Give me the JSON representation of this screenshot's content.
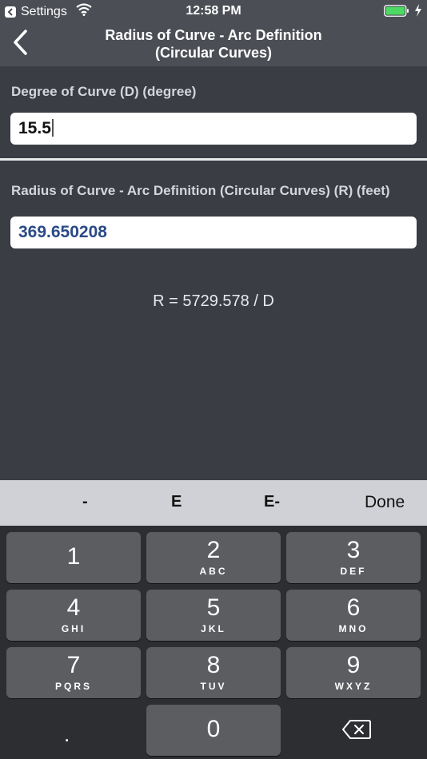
{
  "status": {
    "back_app": "Settings",
    "time": "12:58 PM"
  },
  "nav": {
    "title_line1": "Radius of Curve - Arc Definition",
    "title_line2": "(Circular Curves)"
  },
  "input": {
    "label": "Degree of Curve (D) (degree)",
    "value": "15.5"
  },
  "output": {
    "label": "Radius of Curve - Arc Definition (Circular Curves) (R) (feet)",
    "value": "369.650208"
  },
  "formula": "R = 5729.578 / D",
  "accessory": {
    "minus": "-",
    "e": "E",
    "e_minus": "E-",
    "done": "Done"
  },
  "keypad": {
    "keys": [
      {
        "num": "1",
        "letters": ""
      },
      {
        "num": "2",
        "letters": "ABC"
      },
      {
        "num": "3",
        "letters": "DEF"
      },
      {
        "num": "4",
        "letters": "GHI"
      },
      {
        "num": "5",
        "letters": "JKL"
      },
      {
        "num": "6",
        "letters": "MNO"
      },
      {
        "num": "7",
        "letters": "PQRS"
      },
      {
        "num": "8",
        "letters": "TUV"
      },
      {
        "num": "9",
        "letters": "WXYZ"
      }
    ],
    "dot": ".",
    "zero": "0"
  }
}
